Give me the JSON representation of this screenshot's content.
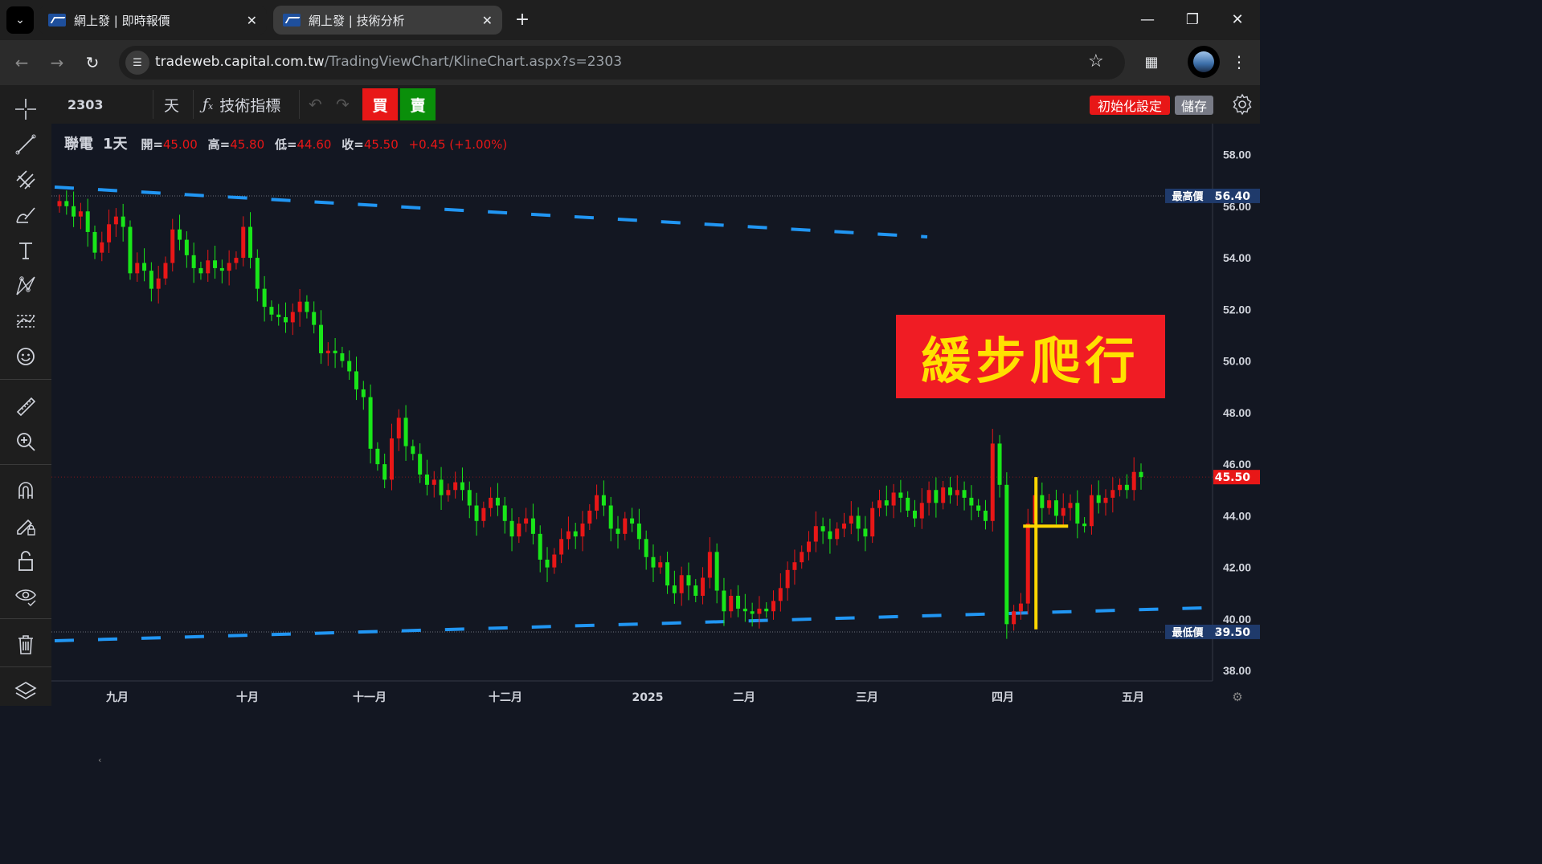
{
  "browser": {
    "tabs": [
      {
        "title": "網上發 | 即時報價",
        "active": false
      },
      {
        "title": "網上發 | 技術分析",
        "active": true
      }
    ],
    "url_host": "tradeweb.capital.com.tw",
    "url_path": "/TradingViewChart/KlineChart.aspx?s=2303"
  },
  "toolbar": {
    "symbol": "2303",
    "interval": "天",
    "indicators_label": "技術指標",
    "buy_label": "買",
    "sell_label": "賣",
    "reset_label": "初始化設定",
    "save_label": "儲存"
  },
  "legend": {
    "name": "聯電",
    "interval": "1天",
    "open_label": "開=",
    "open": "45.00",
    "high_label": "高=",
    "high": "45.80",
    "low_label": "低=",
    "low": "44.60",
    "close_label": "收=",
    "close": "45.50",
    "change": "+0.45 (+1.00%)"
  },
  "annotation": "緩步爬行",
  "colors": {
    "up": "#e81717",
    "down": "#19e619",
    "trend": "#2196f3",
    "annotation_bg": "#f01c24",
    "annotation_text": "#ffe100",
    "marker": "#ffd600"
  },
  "chart_data": {
    "type": "candlestick",
    "ylim": [
      37.6,
      59.2
    ],
    "y_ticks": [
      "58.00",
      "56.00",
      "54.00",
      "52.00",
      "50.00",
      "48.00",
      "46.00",
      "44.00",
      "42.00",
      "40.00",
      "38.00"
    ],
    "x_labels": [
      "九月",
      "十月",
      "十一月",
      "十二月",
      "2025",
      "二月",
      "三月",
      "四月",
      "五月"
    ],
    "high_marker": {
      "label": "最高價",
      "value": "56.40"
    },
    "low_marker": {
      "label": "最低價",
      "value": "39.50"
    },
    "last_price": "45.50",
    "closes": [
      56.2,
      56.0,
      55.6,
      55.8,
      55.0,
      54.2,
      54.6,
      55.3,
      55.6,
      55.2,
      53.4,
      53.8,
      53.5,
      52.8,
      53.2,
      53.8,
      55.1,
      54.7,
      54.1,
      53.6,
      53.4,
      53.9,
      53.6,
      53.5,
      53.8,
      54.0,
      55.2,
      54.0,
      52.8,
      52.1,
      51.8,
      51.7,
      51.5,
      51.9,
      52.3,
      51.9,
      51.4,
      50.3,
      50.4,
      50.3,
      50.0,
      49.6,
      48.9,
      48.6,
      46.6,
      46.0,
      45.4,
      47.0,
      47.8,
      46.7,
      46.4,
      45.6,
      45.2,
      45.4,
      44.8,
      45.0,
      45.3,
      45.0,
      44.4,
      43.8,
      44.3,
      44.7,
      44.4,
      43.8,
      43.2,
      43.7,
      43.9,
      43.3,
      42.3,
      42.0,
      42.5,
      43.1,
      43.4,
      43.2,
      43.7,
      44.2,
      44.8,
      44.4,
      43.5,
      43.3,
      43.9,
      43.7,
      43.1,
      42.4,
      42.0,
      42.2,
      41.3,
      41.0,
      41.7,
      41.3,
      40.9,
      41.6,
      42.6,
      41.1,
      40.3,
      40.9,
      40.4,
      40.3,
      40.2,
      40.4,
      40.3,
      40.7,
      41.2,
      41.9,
      42.2,
      42.6,
      43.0,
      43.6,
      43.4,
      43.1,
      43.5,
      43.7,
      44.0,
      43.5,
      43.2,
      44.3,
      44.6,
      44.4,
      44.9,
      44.7,
      44.2,
      43.9,
      44.5,
      45.0,
      44.5,
      45.1,
      44.8,
      45.0,
      44.7,
      44.4,
      44.2,
      43.8,
      46.8,
      45.2,
      39.8,
      40.3,
      40.6,
      43.7,
      44.8,
      44.3,
      44.6,
      44.0,
      44.3,
      44.5,
      43.7,
      43.6,
      44.8,
      44.5,
      44.7,
      45.0,
      45.2,
      45.0,
      45.7,
      45.5
    ]
  }
}
